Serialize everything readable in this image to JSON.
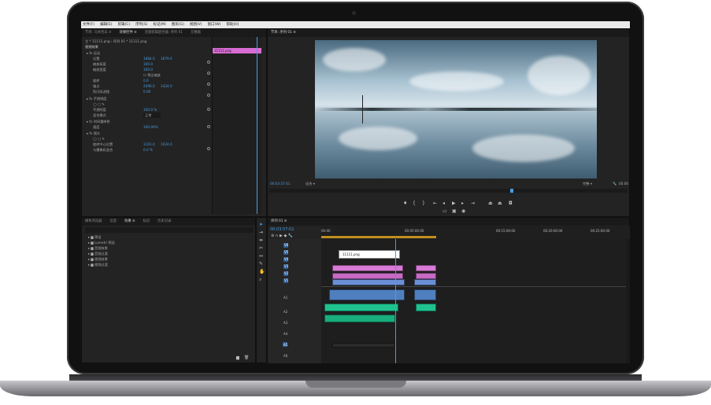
{
  "menu": [
    "文件(F)",
    "编辑(E)",
    "剪辑(C)",
    "序列(S)",
    "标记(M)",
    "图形(G)",
    "视图(V)",
    "窗口(W)",
    "帮助(H)"
  ],
  "left_top": {
    "tabs": [
      "节目: 乌木西岛 ≡",
      "效果控件 ≡",
      "音频剪辑混合器: 序列 01",
      "元数据"
    ],
    "source_line": "主 * 11111.png  ›  序列 01 * 11111.png",
    "clip_label": "11111.png",
    "section_video": "视频效果",
    "motion": "运动",
    "position_label": "位置",
    "position_x": "1884.0",
    "position_y": "1879.0",
    "scale_label": "缩放高度",
    "scale_val": "100.0",
    "scale_w_label": "缩放宽度",
    "scale_w_val": "100.0",
    "uniform_label": "等比缩放",
    "rotation_label": "旋转",
    "rotation_val": "0.0",
    "anchor_label": "锚点",
    "anchor_x": "2096.0",
    "anchor_y": "1424.0",
    "flicker_label": "防闪烁滤镜",
    "flicker_val": "0.00",
    "opacity_section": "不透明度",
    "opacity_label": "不透明度",
    "opacity_val": "100.0 %",
    "blend_label": "混合模式",
    "blend_val": "正常",
    "time_remap": "时间重映射",
    "speed_label": "速度",
    "speed_val": "100.00%",
    "lens_section": "镜头",
    "center_label": "旋转中心位置",
    "center_x": "1101.0",
    "center_y": "1024.0",
    "fov_label": "与摄像机混合",
    "fov_val": "0.0 %",
    "timecode": "00:03:57:01"
  },
  "left_bottom": {
    "tabs": [
      "媒体浏览器",
      "信息",
      "效果 ≡",
      "标记",
      "历史记录"
    ],
    "items": [
      "预设",
      "Lumetri 预设",
      "音频效果",
      "音频过渡",
      "视频效果",
      "视频过渡"
    ]
  },
  "program": {
    "tab": "节目: 序列 01 ≡",
    "timecode": "00:03:57:01",
    "fit": "适合",
    "quality": "完整",
    "duration": "00:00"
  },
  "timeline": {
    "tab": "序列 01 ≡",
    "timecode": "00:03:57:01",
    "ruler": [
      "00:00",
      "00:05:00:00",
      "00:10:00:00",
      "00:15:00:00",
      "00:20:00:00",
      "00:25:00:00"
    ],
    "video_tracks": [
      "V6",
      "V5",
      "V4",
      "V3",
      "V2",
      "V1"
    ],
    "audio_tracks": [
      "A1",
      "A2",
      "A3",
      "A4",
      "A5",
      "A6"
    ],
    "title_clip": "11111.png"
  }
}
